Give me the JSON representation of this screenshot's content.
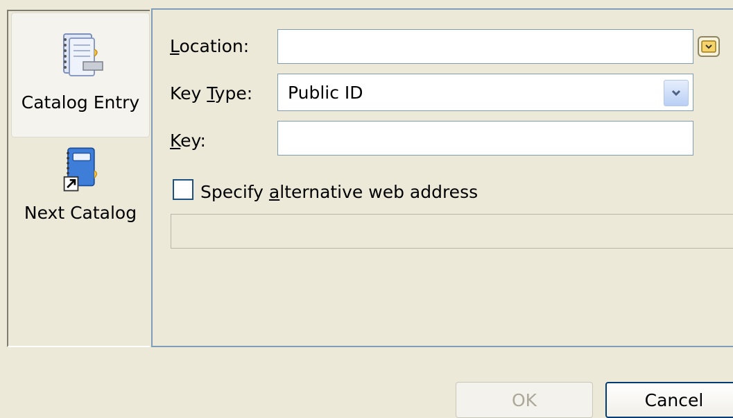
{
  "sidebar": {
    "items": [
      {
        "label": "Catalog Entry",
        "icon": "catalog-entry-icon",
        "selected": true
      },
      {
        "label": "Next Catalog",
        "icon": "next-catalog-icon",
        "selected": false
      }
    ]
  },
  "form": {
    "location": {
      "label_accel": "L",
      "label_rest": "ocation:",
      "value": ""
    },
    "key_type": {
      "label_pre": "Key ",
      "label_accel": "T",
      "label_rest": "ype:",
      "value": "Public ID"
    },
    "key": {
      "label_accel": "K",
      "label_rest": "ey:",
      "value": ""
    },
    "alt_web": {
      "label_pre": "Specify ",
      "label_accel": "a",
      "label_rest": "lternative web address",
      "checked": false,
      "value": ""
    }
  },
  "buttons": {
    "ok": "OK",
    "cancel": "Cancel"
  },
  "colors": {
    "background": "#ece9d8",
    "field_border": "#7f9db9",
    "disabled_text": "#aca899"
  }
}
